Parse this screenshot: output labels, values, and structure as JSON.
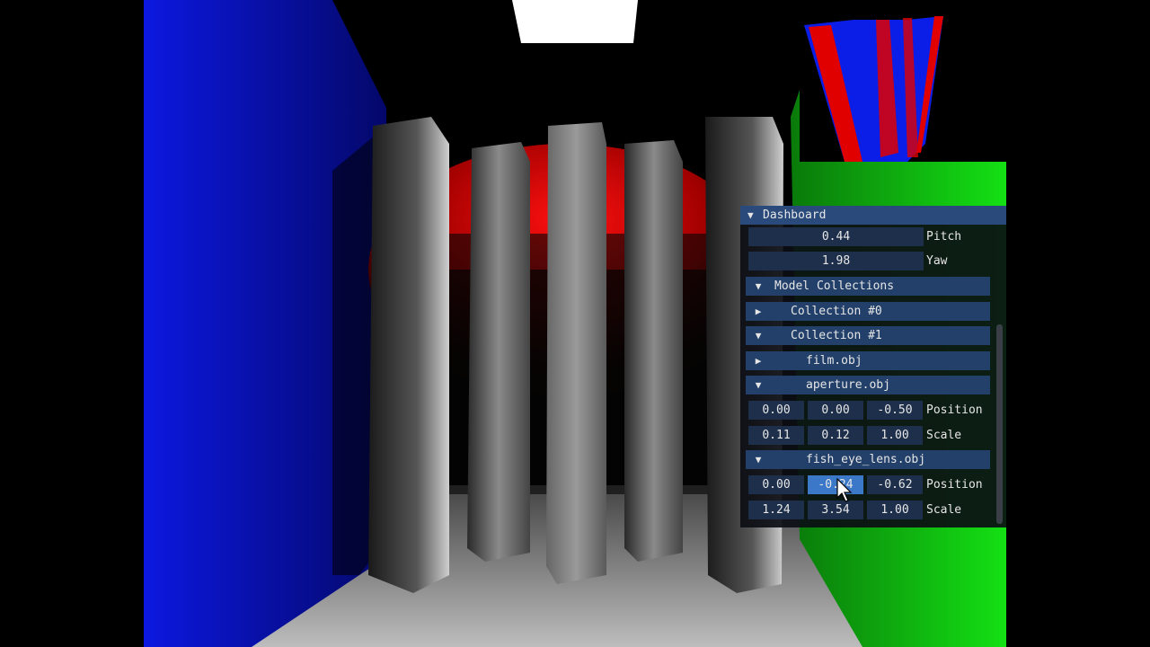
{
  "dashboard": {
    "title": "Dashboard",
    "pitch": {
      "value": "0.44",
      "label": "Pitch"
    },
    "yaw": {
      "value": "1.98",
      "label": "Yaw"
    },
    "model_collections": {
      "label": "Model Collections"
    },
    "collection0": {
      "label": "Collection #0"
    },
    "collection1": {
      "label": "Collection #1"
    },
    "film": {
      "label": "film.obj"
    },
    "aperture": {
      "label": "aperture.obj",
      "position": {
        "x": "0.00",
        "y": "0.00",
        "z": "-0.50",
        "label": "Position"
      },
      "scale": {
        "x": "0.11",
        "y": "0.12",
        "z": "1.00",
        "label": "Scale"
      }
    },
    "fish_eye": {
      "label": "fish_eye_lens.obj",
      "position": {
        "x": "0.00",
        "y": "-0.24",
        "z": "-0.62",
        "label": "Position"
      },
      "scale": {
        "x": "1.24",
        "y": "3.54",
        "z": "1.00",
        "label": "Scale"
      }
    }
  },
  "icons": {
    "expanded": "▼",
    "collapsed": "▶"
  },
  "colors": {
    "left_wall": "#0a14d8",
    "right_wall": "#10dd10",
    "red_band": "#e00000",
    "panel_title": "#294a7a",
    "panel_field": "#1d2f4a",
    "panel_active": "#3c78c8"
  }
}
